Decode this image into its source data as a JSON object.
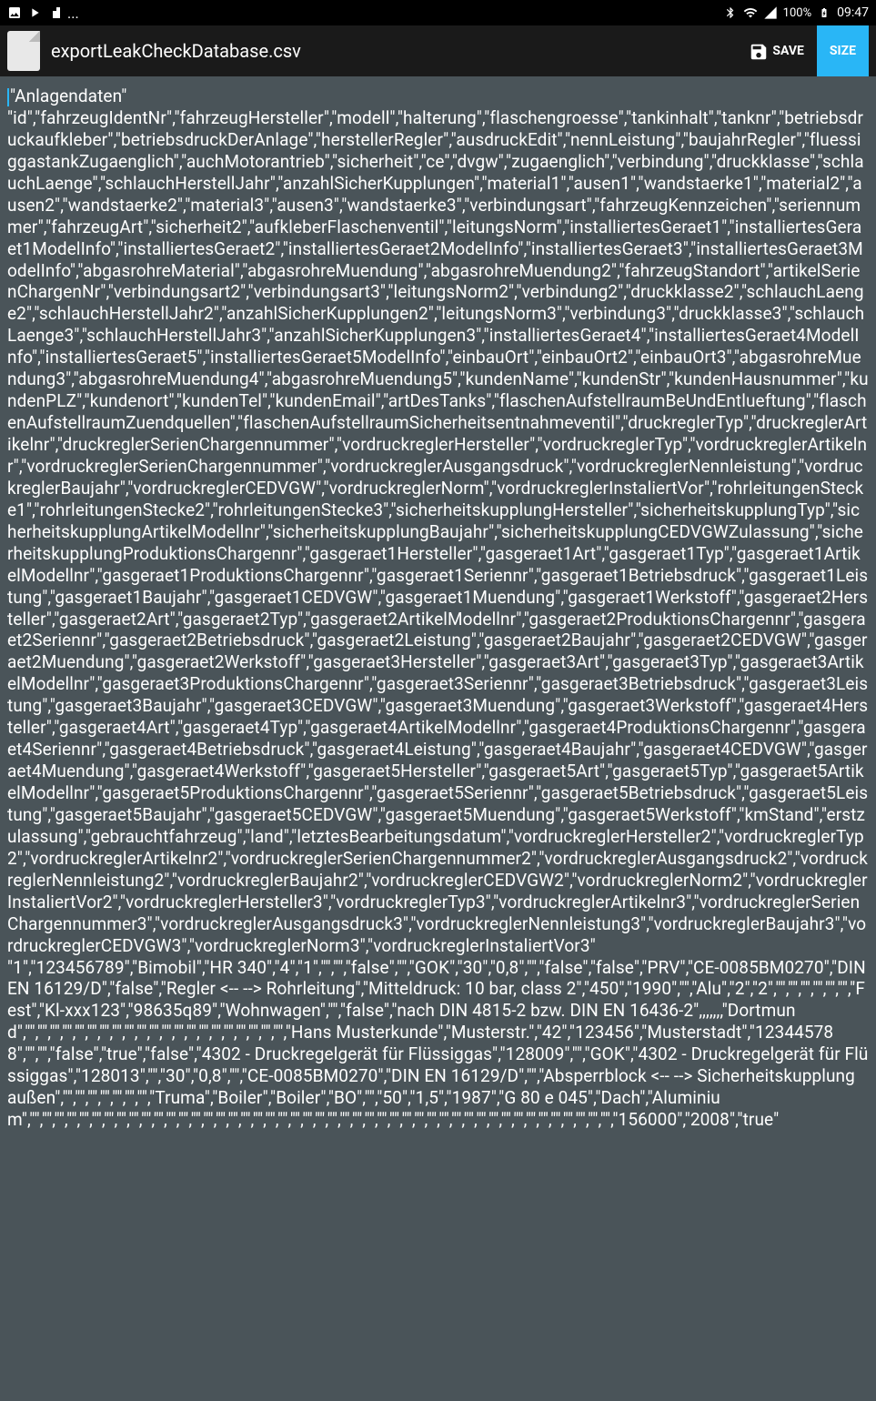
{
  "status": {
    "time": "09:47",
    "battery": "100%"
  },
  "header": {
    "filename": "exportLeakCheckDatabase.csv",
    "save_label": "SAVE",
    "size_label": "SIZE"
  },
  "csv": {
    "line1": "\"Anlagendaten\"",
    "line2": "\"id\",\"fahrzeugIdentNr\",\"fahrzeugHersteller\",\"modell\",\"halterung\",\"flaschengroesse\",\"tankinhalt\",\"tanknr\",\"betriebsdruckaufkleber\",\"betriebsdruckDerAnlage\",\"herstellerRegler\",\"ausdruckEdit\",\"nennLeistung\",\"baujahrRegler\",\"fluessiggastankZugaenglich\",\"auchMotorantrieb\",\"sicherheit\",\"ce\",\"dvgw\",\"zugaenglich\",\"verbindung\",\"druckklasse\",\"schlauchLaenge\",\"schlauchHerstellJahr\",\"anzahlSicherKupplungen\",\"material1\",\"ausen1\",\"wandstaerke1\",\"material2\",\"ausen2\",\"wandstaerke2\",\"material3\",\"ausen3\",\"wandstaerke3\",\"verbindungsart\",\"fahrzeugKennzeichen\",\"seriennummer\",\"fahrzeugArt\",\"sicherheit2\",\"aufkleberFlaschenventil\",\"leitungsNorm\",\"installiertesGeraet1\",\"installiertesGeraet1ModelInfo\",\"installiertesGeraet2\",\"installiertesGeraet2ModelInfo\",\"installiertesGeraet3\",\"installiertesGeraet3ModelInfo\",\"abgasrohreMaterial\",\"abgasrohreMuendung\",\"abgasrohreMuendung2\",\"fahrzeugStandort\",\"artikelSerienChargenNr\",\"verbindungsart2\",\"verbindungsart3\",\"leitungsNorm2\",\"verbindung2\",\"druckklasse2\",\"schlauchLaenge2\",\"schlauchHerstellJahr2\",\"anzahlSicherKupplungen2\",\"leitungsNorm3\",\"verbindung3\",\"druckklasse3\",\"schlauchLaenge3\",\"schlauchHerstellJahr3\",\"anzahlSicherKupplungen3\",\"installiertesGeraet4\",\"installiertesGeraet4ModelInfo\",\"installiertesGeraet5\",\"installiertesGeraet5ModelInfo\",\"einbauOrt\",\"einbauOrt2\",\"einbauOrt3\",\"abgasrohreMuendung3\",\"abgasrohreMuendung4\",\"abgasrohreMuendung5\",\"kundenName\",\"kundenStr\",\"kundenHausnummer\",\"kundenPLZ\",\"kundenort\",\"kundenTel\",\"kundenEmail\",\"artDesTanks\",\"flaschenAufstellraumBeUndEntlueftung\",\"flaschenAufstellraumZuendquellen\",\"flaschenAufstellraumSicherheitsentnahmeventil\",\"druckreglerTyp\",\"druckreglerArtikelnr\",\"druckreglerSerienChargennummer\",\"vordruckreglerHersteller\",\"vordruckreglerTyp\",\"vordruckreglerArtikelnr\",\"vordruckreglerSerienChargennummer\",\"vordruckreglerAusgangsdruck\",\"vordruckreglerNennleistung\",\"vordruckreglerBaujahr\",\"vordruckreglerCEDVGW\",\"vordruckreglerNorm\",\"vordruckreglerInstaliertVor\",\"rohrleitungenStecke1\",\"rohrleitungenStecke2\",\"rohrleitungenStecke3\",\"sicherheitskupplungHersteller\",\"sicherheitskupplungTyp\",\"sicherheitskupplungArtikelModellnr\",\"sicherheitskupplungBaujahr\",\"sicherheitskupplungCEDVGWZulassung\",\"sicherheitskupplungProduktionsChargennr\",\"gasgeraet1Hersteller\",\"gasgeraet1Art\",\"gasgeraet1Typ\",\"gasgeraet1ArtikelModellnr\",\"gasgeraet1ProduktionsChargennr\",\"gasgeraet1Seriennr\",\"gasgeraet1Betriebsdruck\",\"gasgeraet1Leistung\",\"gasgeraet1Baujahr\",\"gasgeraet1CEDVGW\",\"gasgeraet1Muendung\",\"gasgeraet1Werkstoff\",\"gasgeraet2Hersteller\",\"gasgeraet2Art\",\"gasgeraet2Typ\",\"gasgeraet2ArtikelModellnr\",\"gasgeraet2ProduktionsChargennr\",\"gasgeraet2Seriennr\",\"gasgeraet2Betriebsdruck\",\"gasgeraet2Leistung\",\"gasgeraet2Baujahr\",\"gasgeraet2CEDVGW\",\"gasgeraet2Muendung\",\"gasgeraet2Werkstoff\",\"gasgeraet3Hersteller\",\"gasgeraet3Art\",\"gasgeraet3Typ\",\"gasgeraet3ArtikelModellnr\",\"gasgeraet3ProduktionsChargennr\",\"gasgeraet3Seriennr\",\"gasgeraet3Betriebsdruck\",\"gasgeraet3Leistung\",\"gasgeraet3Baujahr\",\"gasgeraet3CEDVGW\",\"gasgeraet3Muendung\",\"gasgeraet3Werkstoff\",\"gasgeraet4Hersteller\",\"gasgeraet4Art\",\"gasgeraet4Typ\",\"gasgeraet4ArtikelModellnr\",\"gasgeraet4ProduktionsChargennr\",\"gasgeraet4Seriennr\",\"gasgeraet4Betriebsdruck\",\"gasgeraet4Leistung\",\"gasgeraet4Baujahr\",\"gasgeraet4CEDVGW\",\"gasgeraet4Muendung\",\"gasgeraet4Werkstoff\",\"gasgeraet5Hersteller\",\"gasgeraet5Art\",\"gasgeraet5Typ\",\"gasgeraet5ArtikelModellnr\",\"gasgeraet5ProduktionsChargennr\",\"gasgeraet5Seriennr\",\"gasgeraet5Betriebsdruck\",\"gasgeraet5Leistung\",\"gasgeraet5Baujahr\",\"gasgeraet5CEDVGW\",\"gasgeraet5Muendung\",\"gasgeraet5Werkstoff\",\"kmStand\",\"erstzulassung\",\"gebrauchtfahrzeug\",\"land\",\"letztesBearbeitungsdatum\",\"vordruckreglerHersteller2\",\"vordruckreglerTyp2\",\"vordruckreglerArtikelnr2\",\"vordruckreglerSerienChargennummer2\",\"vordruckreglerAusgangsdruck2\",\"vordruckreglerNennleistung2\",\"vordruckreglerBaujahr2\",\"vordruckreglerCEDVGW2\",\"vordruckreglerNorm2\",\"vordruckreglerInstaliertVor2\",\"vordruckreglerHersteller3\",\"vordruckreglerTyp3\",\"vordruckreglerArtikelnr3\",\"vordruckreglerSerienChargennummer3\",\"vordruckreglerAusgangsdruck3\",\"vordruckreglerNennleistung3\",\"vordruckreglerBaujahr3\",\"vordruckreglerCEDVGW3\",\"vordruckreglerNorm3\",\"vordruckreglerInstaliertVor3\"",
    "line3": "\"1\",\"123456789\",\"Bimobil\",\"HR 340\",\"4\",\"1\",\"\",\"\",\"false\",\"\",\"GOK\",\"30\",\"0,8\",\"\",\"false\",\"false\",\"PRV\",\"CE-0085BM0270\",\"DIN EN 16129/D\",\"false\",\"Regler <-- --> Rohrleitung\",\"Mitteldruck: 10 bar, class 2\",\"450\",\"1990\",\"\",\"Alu\",\"2\",\"2\",\"\",\"\",\"\",\"\",\"\",\"\",\"Fest\",\"Kl-xxx123\",\"98635q89\",\"Wohnwagen\",\"\",\"false\",\"nach DIN 4815-2 bzw. DIN EN 16436-2\",,,,,,,\"Dortmund\",\"\",\"\",\"\",\"\",\"\",\"\",\"\",\"\",\"\",\"\",\"\",\"\",\"\",\"\",\"\",\"\",\"\",\"\",\"\",\"\",\"\",\"Hans Musterkunde\",\"Musterstr.\",\"42\",\"123456\",\"Musterstadt\",\"123445788\",\"\",\"\",\"false\",\"true\",\"false\",\"4302 - Druckregelgerät für Flüssiggas\",\"128009\",\"\",\"GOK\",\"4302 - Druckregelgerät für Flüssiggas\",\"128013\",\"\",\"30\",\"0,8\",\"\",\"CE-0085BM0270\",\"DIN EN 16129/D\",\"\",\"Absperrblock <-- --> Sicherheitskupplung außen\",\"\",\"\",\"\",\"\",\"\",\"\",\"\",\"Truma\",\"Boiler\",\"Boiler\",\"BO\",\"\",\"50\",\"1,5\",\"1987\",\"G 80 e 045\",\"Dach\",\"Aluminium\",\"\",\"\",\"\",\"\",\"\",\"\",\"\",\"\",\"\",\"\",\"\",\"\",\"\",\"\",\"\",\"\",\"\",\"\",\"\",\"\",\"\",\"\",\"\",\"\",\"\",\"\",\"\",\"\",\"\",\"\",\"\",\"\",\"\",\"\",\"\",\"\",\"\",\"\",\"\",\"\",\"\",\"\",\"\",\"\",\"\",\"\",\"\",\"156000\",\"2008\",\"true\""
  }
}
